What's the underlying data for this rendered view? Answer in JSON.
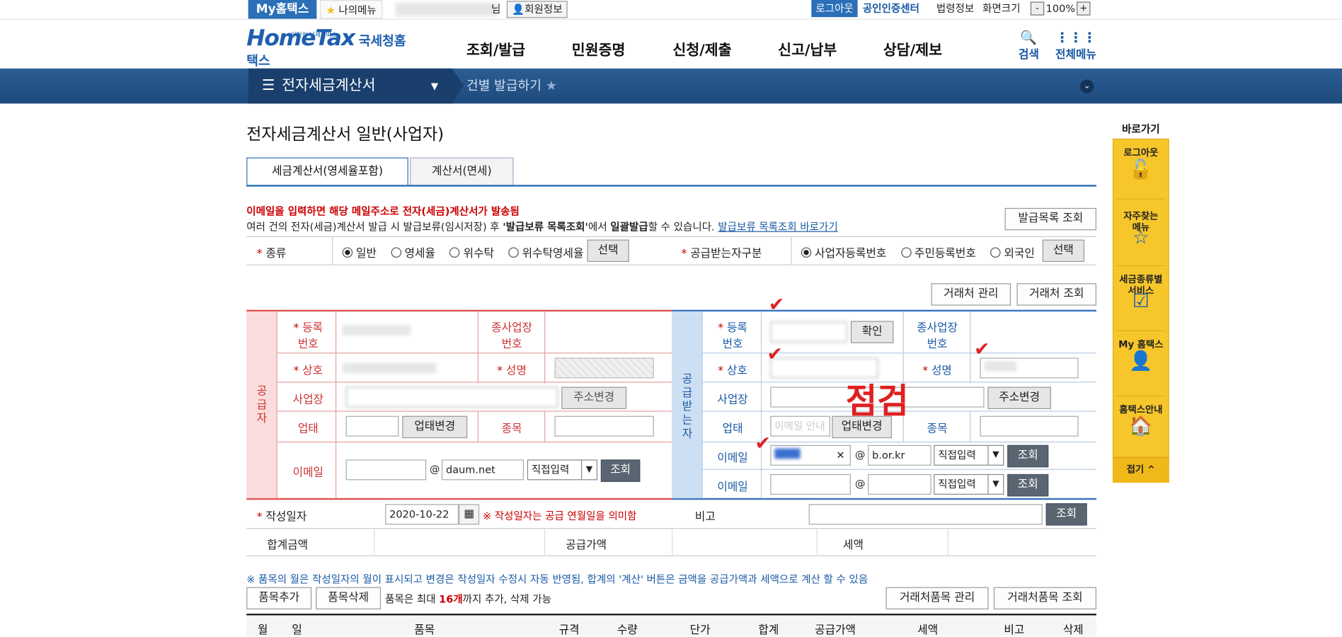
{
  "topbar": {
    "my_hometax": "My홈택스",
    "my_menu": "나의메뉴",
    "user_suffix": "님",
    "member_info": "회원정보",
    "logout": "로그아웃",
    "cert_center": "공인인증센터",
    "law_info": "법령정보",
    "screen_size": "화면크기",
    "zoom_minus": "-",
    "zoom_value": "100%",
    "zoom_plus": "+"
  },
  "header": {
    "logo_main": "HomeTax",
    "logo_sub": "국세청홈택스",
    "logo_tag": "안전한 납세서비스",
    "gnb": [
      "조회/발급",
      "민원증명",
      "신청/제출",
      "신고/납부",
      "상담/제보"
    ],
    "search": "검색",
    "all_menu": "전체메뉴"
  },
  "navbar": {
    "section": "전자세금계산서",
    "sub": "건별 발급하기"
  },
  "page": {
    "title": "전자세금계산서 일반(사업자)",
    "tabs": [
      "세금계산서(영세율포함)",
      "계산서(면세)"
    ],
    "red_msg": "이메일을 입력하면 해당 메일주소로 전자(세금)계산서가 발송됨",
    "info_msg_1": "여러 건의 전자(세금)계산서 발급 시 발급보류(임시저장) 후 ",
    "info_msg_bold1": "'발급보류 목록조회'",
    "info_msg_2": "에서 ",
    "info_msg_bold2": "일괄발급",
    "info_msg_3": "할 수 있습니다.",
    "info_link": "발급보류 목록조회 바로가기",
    "issue_list_btn": "발급목록 조회"
  },
  "kind": {
    "label": "종류",
    "options": [
      "일반",
      "영세율",
      "위수탁",
      "위수탁영세율"
    ],
    "selected": "일반",
    "select_btn": "선택"
  },
  "receiver_type": {
    "label": "공급받는자구분",
    "options": [
      "사업자등록번호",
      "주민등록번호",
      "외국인"
    ],
    "selected": "사업자등록번호",
    "select_btn": "선택"
  },
  "partner_btns": [
    "거래처 관리",
    "거래처 조회"
  ],
  "supplier": {
    "side_label": "공급자",
    "reg_no_label": "등록\n번호",
    "sub_biz_label": "종사업장\n번호",
    "company_label": "상호",
    "name_label": "성명",
    "address_label": "사업장",
    "address_btn": "주소변경",
    "biz_type_label": "업태",
    "biz_type_btn": "업태변경",
    "item_label": "종목",
    "email_label": "이메일",
    "email_at": "@",
    "email_domain": "daum.net",
    "email_select": "직접입력",
    "email_btn": "조회"
  },
  "receiver": {
    "side_label": "공급받는자",
    "reg_no_label": "등록\n번호",
    "confirm_btn": "확인",
    "sub_biz_label": "종사업장\n번호",
    "company_label": "상호",
    "name_label": "성명",
    "address_label": "사업장",
    "address_btn": "주소변경",
    "biz_type_label": "업태",
    "biz_type_placeholder": "이메일 안내",
    "biz_type_btn": "업태변경",
    "item_label": "종목",
    "email_label": "이메일",
    "email_at": "@",
    "email_domain": "b.or.kr",
    "email_select": "직접입력",
    "email_btn": "조회",
    "email2_label": "이메일",
    "email2_at": "@",
    "email2_select": "직접입력",
    "email2_btn": "조회",
    "handwriting": "점검"
  },
  "write_date": {
    "label": "작성일자",
    "value": "2020-10-22",
    "note": "※ 작성일자는 공급 연월일을 의미함",
    "remark_label": "비고",
    "remark_btn": "조회"
  },
  "sums": {
    "total": "합계금액",
    "supply": "공급가액",
    "tax": "세액"
  },
  "items": {
    "notice": "※ 품목의 월은 작성일자의 월이 표시되고 변경은 작성일자 수정시 자동 반영됨, 합계의 '계산' 버튼은 금액을 공급가액과 세액으로 계산 할 수 있음",
    "add_btn": "품목추가",
    "del_btn": "품목삭제",
    "limit_1": "품목은 최대 ",
    "limit_num": "16개",
    "limit_2": "까지 추가, 삭제 가능",
    "partner_item_mgmt": "거래처품목 관리",
    "partner_item_search": "거래처품목 조회",
    "headers": [
      "월",
      "일",
      "품목",
      "규격",
      "수량",
      "단가",
      "합계",
      "공급가액",
      "세액",
      "비고",
      "삭제"
    ]
  },
  "quick": {
    "title": "바로가기",
    "items": [
      {
        "label": "로그아웃",
        "icon": "unlock-icon"
      },
      {
        "label": "자주찾는\n메뉴",
        "icon": "star-icon"
      },
      {
        "label": "세금종류별\n서비스",
        "icon": "checkbox-icon"
      },
      {
        "label": "My 홈택스",
        "icon": "person-icon"
      },
      {
        "label": "홈택스안내",
        "icon": "house-icon"
      }
    ],
    "collapse": "접기"
  }
}
